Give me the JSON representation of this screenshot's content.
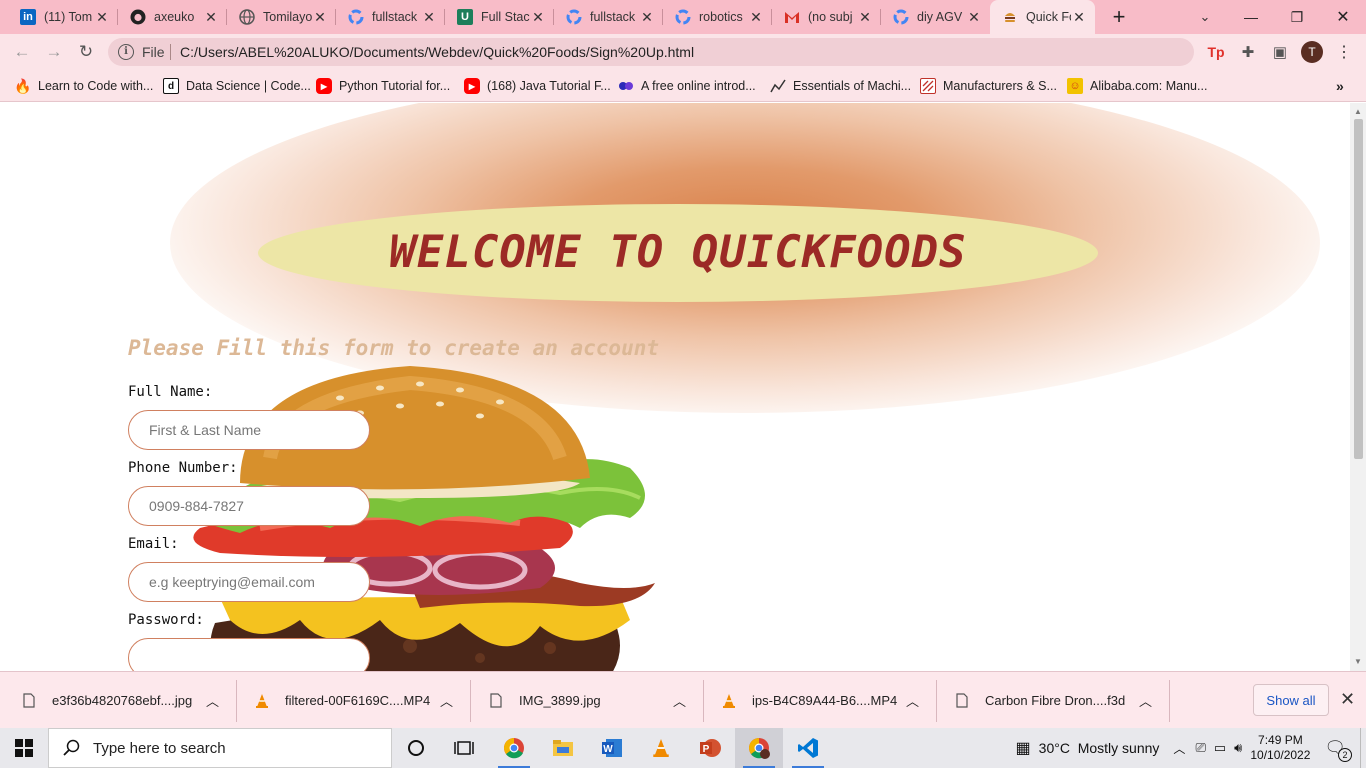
{
  "browser": {
    "tabs": [
      {
        "title": "(11) Tom",
        "icon": "linkedin-icon"
      },
      {
        "title": "axeuko",
        "icon": "github-icon"
      },
      {
        "title": "Tomilayo",
        "icon": "globe-icon"
      },
      {
        "title": "fullstack",
        "icon": "google-icon"
      },
      {
        "title": "Full Stac",
        "icon": "udemy-icon"
      },
      {
        "title": "fullstack",
        "icon": "google-icon"
      },
      {
        "title": "robotics",
        "icon": "google-icon"
      },
      {
        "title": "(no subj",
        "icon": "gmail-icon"
      },
      {
        "title": "diy AGV",
        "icon": "google-icon"
      },
      {
        "title": "Quick Fo",
        "icon": "burger-favicon-icon"
      }
    ],
    "address": {
      "scheme_label": "File",
      "url": "C:/Users/ABEL%20ALUKO/Documents/Webdev/Quick%20Foods/Sign%20Up.html"
    },
    "profile_initial": "T",
    "bookmarks": [
      {
        "label": "Learn to Code with...",
        "icon": "freecodecamp-icon"
      },
      {
        "label": "Data Science | Code...",
        "icon": "datacamp-icon"
      },
      {
        "label": "Python Tutorial for...",
        "icon": "youtube-icon"
      },
      {
        "label": "(168) Java Tutorial F...",
        "icon": "youtube-icon"
      },
      {
        "label": "A free online introd...",
        "icon": "elements-of-ai-icon"
      },
      {
        "label": "Essentials of Machi...",
        "icon": "chart-icon"
      },
      {
        "label": "Manufacturers & S...",
        "icon": "made-in-china-icon"
      },
      {
        "label": "Alibaba.com: Manu...",
        "icon": "alibaba-icon"
      }
    ]
  },
  "page": {
    "heading": "WELCOME TO QUICKFOODS",
    "subtitle": "Please Fill this form to create an account",
    "form": {
      "full_name": {
        "label": "Full Name:",
        "placeholder": "First & Last Name"
      },
      "phone": {
        "label": "Phone Number:",
        "placeholder": "0909-884-7827"
      },
      "email": {
        "label": "Email:",
        "placeholder": "e.g keeptrying@email.com"
      },
      "password": {
        "label": "Password:",
        "placeholder": ""
      }
    },
    "colors": {
      "heading": "#9c2a26",
      "heading_bg": "#ede6a6",
      "subtitle": "#dcb896",
      "input_border": "#d08060"
    }
  },
  "downloads": {
    "items": [
      {
        "name": "e3f36b4820768ebf....jpg",
        "icon": "file-icon"
      },
      {
        "name": "filtered-00F6169C....MP4",
        "icon": "vlc-icon"
      },
      {
        "name": "IMG_3899.jpg",
        "icon": "file-icon"
      },
      {
        "name": "ips-B4C89A44-B6....MP4",
        "icon": "vlc-icon"
      },
      {
        "name": "Carbon Fibre Dron....f3d",
        "icon": "file-icon"
      }
    ],
    "show_all": "Show all"
  },
  "taskbar": {
    "search_placeholder": "Type here to search",
    "weather": "30°C  Mostly sunny",
    "time": "7:49 PM",
    "date": "10/10/2022",
    "notifications": "2"
  }
}
